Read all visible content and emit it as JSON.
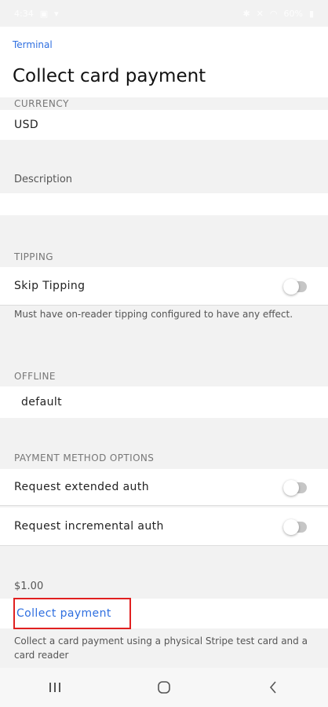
{
  "status": {
    "time": "4:34",
    "battery": "60%"
  },
  "header": {
    "breadcrumb": "Terminal",
    "title": "Collect card payment"
  },
  "form": {
    "currency_label": "CURRENCY",
    "currency_value": "USD",
    "description_placeholder": "Description",
    "tipping_section": "TIPPING",
    "skip_tipping_label": "Skip Tipping",
    "skip_tipping_on": false,
    "tipping_helper": "Must have on-reader tipping configured to have any effect.",
    "offline_section": "OFFLINE",
    "offline_value": "default",
    "pm_section": "PAYMENT METHOD OPTIONS",
    "extended_auth_label": "Request extended auth",
    "extended_auth_on": false,
    "incremental_auth_label": "Request incremental auth",
    "incremental_auth_on": false,
    "amount": "$1.00",
    "collect_button": "Collect payment",
    "collect_helper": "Collect a card payment using a physical Stripe test card and a card reader"
  },
  "colors": {
    "accent": "#2f6fe0",
    "highlight_border": "#e02020"
  },
  "icons": {
    "recents": "recent-apps-icon",
    "home": "home-icon",
    "back": "back-icon"
  }
}
